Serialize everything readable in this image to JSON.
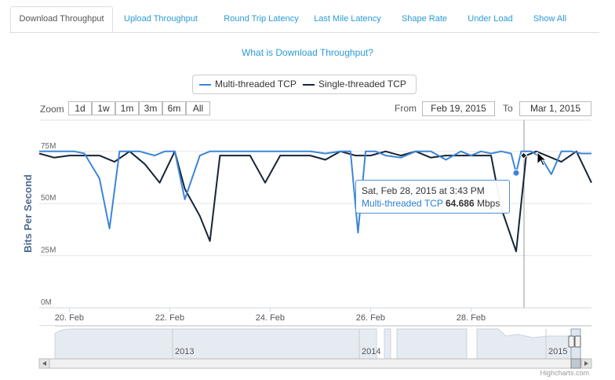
{
  "tabs": [
    {
      "label": "Download Throughput",
      "active": true
    },
    {
      "label": "Upload Throughput",
      "active": false
    },
    {
      "label": "Round Trip Latency",
      "active": false
    },
    {
      "label": "Last Mile Latency",
      "active": false
    },
    {
      "label": "Shape Rate",
      "active": false
    },
    {
      "label": "Under Load",
      "active": false
    },
    {
      "label": "Show All",
      "active": false
    }
  ],
  "whatis_link": "What is Download Throughput?",
  "legend": {
    "multi": "Multi-threaded TCP",
    "single": "Single-threaded TCP"
  },
  "zoom": {
    "label": "Zoom",
    "buttons": [
      "1d",
      "1w",
      "1m",
      "3m",
      "6m",
      "All"
    ]
  },
  "range": {
    "from_label": "From",
    "from_value": "Feb 19, 2015",
    "to_label": "To",
    "to_value": "Mar 1, 2015"
  },
  "tooltip": {
    "date": "Sat, Feb 28, 2015 at 3:43 PM",
    "series": "Multi-threaded TCP",
    "value": "64.686",
    "unit": "Mbps"
  },
  "navigator_labels": [
    "2013",
    "2014",
    "2015"
  ],
  "credits": "Highcharts.com",
  "colors": {
    "multi": "#3d85d8",
    "single": "#162436",
    "accent": "#2a9bd5"
  },
  "chart_data": {
    "type": "line",
    "ylabel": "Bits Per Second",
    "yticks": [
      "0M",
      "25M",
      "50M",
      "75M"
    ],
    "ylim": [
      0,
      90
    ],
    "xticks": [
      "20. Feb",
      "22. Feb",
      "24. Feb",
      "26. Feb",
      "28. Feb"
    ],
    "xlim": [
      19.4,
      30.4
    ],
    "series": [
      {
        "name": "Multi-threaded TCP",
        "x": [
          19.4,
          19.6,
          19.9,
          20.1,
          20.3,
          20.6,
          20.8,
          21.0,
          21.2,
          21.4,
          21.7,
          21.9,
          22.1,
          22.3,
          22.6,
          22.8,
          23.0,
          23.3,
          23.6,
          23.9,
          24.2,
          24.5,
          24.8,
          25.1,
          25.4,
          25.6,
          25.75,
          25.9,
          26.1,
          26.3,
          26.6,
          26.9,
          27.2,
          27.5,
          27.8,
          28.0,
          28.2,
          28.4,
          28.6,
          28.8,
          28.9,
          29.0,
          29.2,
          29.4,
          29.6,
          29.8,
          30.0,
          30.2,
          30.4
        ],
        "values": [
          75,
          75,
          75,
          75,
          74,
          62,
          38,
          75,
          75,
          75,
          73,
          75,
          75,
          52,
          73,
          75,
          75,
          75,
          75,
          75,
          75,
          75,
          75,
          74,
          75,
          75,
          36,
          75,
          75,
          73,
          72,
          75,
          75,
          71,
          75,
          73,
          75,
          74,
          75,
          74,
          64.686,
          75,
          75,
          72,
          64,
          75,
          75,
          74,
          74
        ]
      },
      {
        "name": "Single-threaded TCP",
        "x": [
          19.4,
          19.7,
          20.0,
          20.3,
          20.6,
          20.9,
          21.2,
          21.5,
          21.8,
          22.1,
          22.3,
          22.6,
          22.8,
          23.0,
          23.3,
          23.6,
          23.9,
          24.2,
          24.5,
          24.8,
          25.1,
          25.4,
          25.7,
          26.0,
          26.3,
          26.6,
          26.9,
          27.2,
          27.5,
          27.8,
          28.0,
          28.2,
          28.4,
          28.6,
          28.9,
          29.1,
          29.3,
          29.5,
          29.8,
          30.1,
          30.4
        ],
        "values": [
          74,
          72,
          73,
          73,
          73,
          70,
          75,
          69,
          60,
          75,
          57,
          44,
          32,
          73,
          73,
          73,
          60,
          73,
          73,
          73,
          71,
          75,
          73,
          73,
          75,
          73,
          75,
          72,
          73,
          73,
          73,
          73,
          73,
          48,
          27,
          73,
          75,
          73,
          70,
          75,
          60
        ]
      }
    ]
  }
}
